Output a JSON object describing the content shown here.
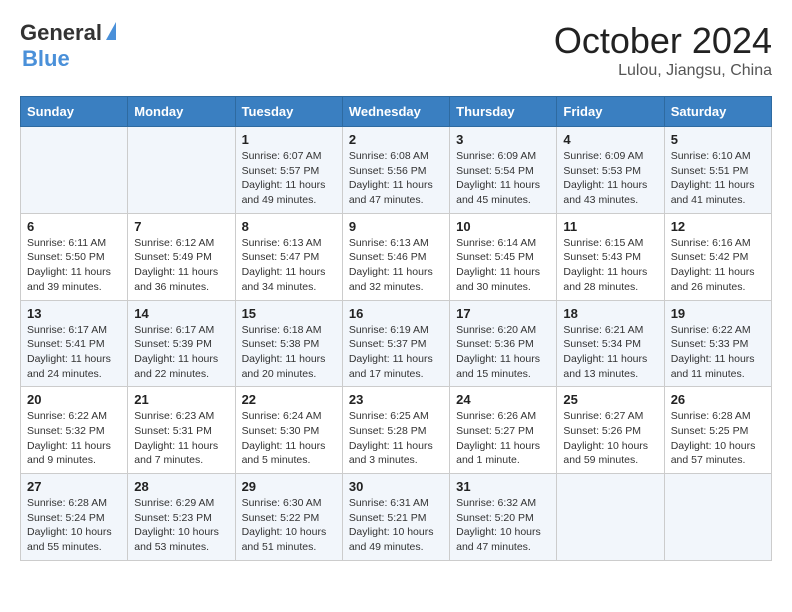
{
  "header": {
    "logo_general": "General",
    "logo_blue": "Blue",
    "month": "October 2024",
    "location": "Lulou, Jiangsu, China"
  },
  "weekdays": [
    "Sunday",
    "Monday",
    "Tuesday",
    "Wednesday",
    "Thursday",
    "Friday",
    "Saturday"
  ],
  "weeks": [
    [
      {
        "day": "",
        "sunrise": "",
        "sunset": "",
        "daylight": ""
      },
      {
        "day": "",
        "sunrise": "",
        "sunset": "",
        "daylight": ""
      },
      {
        "day": "1",
        "sunrise": "Sunrise: 6:07 AM",
        "sunset": "Sunset: 5:57 PM",
        "daylight": "Daylight: 11 hours and 49 minutes."
      },
      {
        "day": "2",
        "sunrise": "Sunrise: 6:08 AM",
        "sunset": "Sunset: 5:56 PM",
        "daylight": "Daylight: 11 hours and 47 minutes."
      },
      {
        "day": "3",
        "sunrise": "Sunrise: 6:09 AM",
        "sunset": "Sunset: 5:54 PM",
        "daylight": "Daylight: 11 hours and 45 minutes."
      },
      {
        "day": "4",
        "sunrise": "Sunrise: 6:09 AM",
        "sunset": "Sunset: 5:53 PM",
        "daylight": "Daylight: 11 hours and 43 minutes."
      },
      {
        "day": "5",
        "sunrise": "Sunrise: 6:10 AM",
        "sunset": "Sunset: 5:51 PM",
        "daylight": "Daylight: 11 hours and 41 minutes."
      }
    ],
    [
      {
        "day": "6",
        "sunrise": "Sunrise: 6:11 AM",
        "sunset": "Sunset: 5:50 PM",
        "daylight": "Daylight: 11 hours and 39 minutes."
      },
      {
        "day": "7",
        "sunrise": "Sunrise: 6:12 AM",
        "sunset": "Sunset: 5:49 PM",
        "daylight": "Daylight: 11 hours and 36 minutes."
      },
      {
        "day": "8",
        "sunrise": "Sunrise: 6:13 AM",
        "sunset": "Sunset: 5:47 PM",
        "daylight": "Daylight: 11 hours and 34 minutes."
      },
      {
        "day": "9",
        "sunrise": "Sunrise: 6:13 AM",
        "sunset": "Sunset: 5:46 PM",
        "daylight": "Daylight: 11 hours and 32 minutes."
      },
      {
        "day": "10",
        "sunrise": "Sunrise: 6:14 AM",
        "sunset": "Sunset: 5:45 PM",
        "daylight": "Daylight: 11 hours and 30 minutes."
      },
      {
        "day": "11",
        "sunrise": "Sunrise: 6:15 AM",
        "sunset": "Sunset: 5:43 PM",
        "daylight": "Daylight: 11 hours and 28 minutes."
      },
      {
        "day": "12",
        "sunrise": "Sunrise: 6:16 AM",
        "sunset": "Sunset: 5:42 PM",
        "daylight": "Daylight: 11 hours and 26 minutes."
      }
    ],
    [
      {
        "day": "13",
        "sunrise": "Sunrise: 6:17 AM",
        "sunset": "Sunset: 5:41 PM",
        "daylight": "Daylight: 11 hours and 24 minutes."
      },
      {
        "day": "14",
        "sunrise": "Sunrise: 6:17 AM",
        "sunset": "Sunset: 5:39 PM",
        "daylight": "Daylight: 11 hours and 22 minutes."
      },
      {
        "day": "15",
        "sunrise": "Sunrise: 6:18 AM",
        "sunset": "Sunset: 5:38 PM",
        "daylight": "Daylight: 11 hours and 20 minutes."
      },
      {
        "day": "16",
        "sunrise": "Sunrise: 6:19 AM",
        "sunset": "Sunset: 5:37 PM",
        "daylight": "Daylight: 11 hours and 17 minutes."
      },
      {
        "day": "17",
        "sunrise": "Sunrise: 6:20 AM",
        "sunset": "Sunset: 5:36 PM",
        "daylight": "Daylight: 11 hours and 15 minutes."
      },
      {
        "day": "18",
        "sunrise": "Sunrise: 6:21 AM",
        "sunset": "Sunset: 5:34 PM",
        "daylight": "Daylight: 11 hours and 13 minutes."
      },
      {
        "day": "19",
        "sunrise": "Sunrise: 6:22 AM",
        "sunset": "Sunset: 5:33 PM",
        "daylight": "Daylight: 11 hours and 11 minutes."
      }
    ],
    [
      {
        "day": "20",
        "sunrise": "Sunrise: 6:22 AM",
        "sunset": "Sunset: 5:32 PM",
        "daylight": "Daylight: 11 hours and 9 minutes."
      },
      {
        "day": "21",
        "sunrise": "Sunrise: 6:23 AM",
        "sunset": "Sunset: 5:31 PM",
        "daylight": "Daylight: 11 hours and 7 minutes."
      },
      {
        "day": "22",
        "sunrise": "Sunrise: 6:24 AM",
        "sunset": "Sunset: 5:30 PM",
        "daylight": "Daylight: 11 hours and 5 minutes."
      },
      {
        "day": "23",
        "sunrise": "Sunrise: 6:25 AM",
        "sunset": "Sunset: 5:28 PM",
        "daylight": "Daylight: 11 hours and 3 minutes."
      },
      {
        "day": "24",
        "sunrise": "Sunrise: 6:26 AM",
        "sunset": "Sunset: 5:27 PM",
        "daylight": "Daylight: 11 hours and 1 minute."
      },
      {
        "day": "25",
        "sunrise": "Sunrise: 6:27 AM",
        "sunset": "Sunset: 5:26 PM",
        "daylight": "Daylight: 10 hours and 59 minutes."
      },
      {
        "day": "26",
        "sunrise": "Sunrise: 6:28 AM",
        "sunset": "Sunset: 5:25 PM",
        "daylight": "Daylight: 10 hours and 57 minutes."
      }
    ],
    [
      {
        "day": "27",
        "sunrise": "Sunrise: 6:28 AM",
        "sunset": "Sunset: 5:24 PM",
        "daylight": "Daylight: 10 hours and 55 minutes."
      },
      {
        "day": "28",
        "sunrise": "Sunrise: 6:29 AM",
        "sunset": "Sunset: 5:23 PM",
        "daylight": "Daylight: 10 hours and 53 minutes."
      },
      {
        "day": "29",
        "sunrise": "Sunrise: 6:30 AM",
        "sunset": "Sunset: 5:22 PM",
        "daylight": "Daylight: 10 hours and 51 minutes."
      },
      {
        "day": "30",
        "sunrise": "Sunrise: 6:31 AM",
        "sunset": "Sunset: 5:21 PM",
        "daylight": "Daylight: 10 hours and 49 minutes."
      },
      {
        "day": "31",
        "sunrise": "Sunrise: 6:32 AM",
        "sunset": "Sunset: 5:20 PM",
        "daylight": "Daylight: 10 hours and 47 minutes."
      },
      {
        "day": "",
        "sunrise": "",
        "sunset": "",
        "daylight": ""
      },
      {
        "day": "",
        "sunrise": "",
        "sunset": "",
        "daylight": ""
      }
    ]
  ]
}
